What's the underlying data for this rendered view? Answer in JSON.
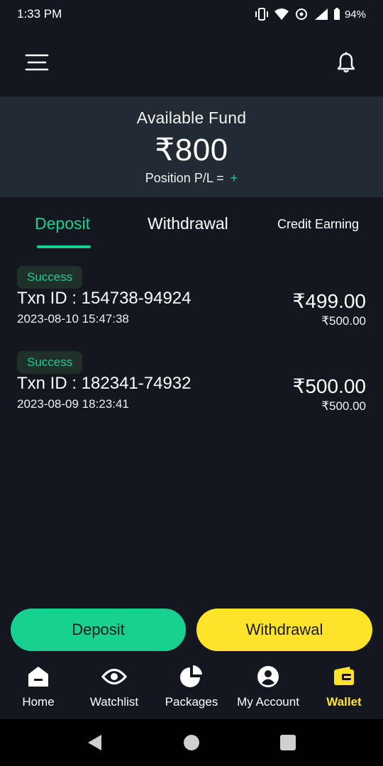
{
  "status_bar": {
    "time": "1:33 PM",
    "battery": "94%"
  },
  "header": {
    "menu_icon": "hamburger-menu-icon",
    "bell_icon": "bell-icon"
  },
  "fund": {
    "label": "Available Fund",
    "amount": "₹800",
    "pl_label": "Position P/L = ",
    "pl_value": "+"
  },
  "tabs": [
    {
      "label": "Deposit",
      "active": true
    },
    {
      "label": "Withdrawal",
      "active": false
    },
    {
      "label": "Credit Earning",
      "active": false
    }
  ],
  "transactions": [
    {
      "status": "Success",
      "txn_id": "Txn ID : 154738-94924",
      "datetime": "2023-08-10 15:47:38",
      "amount": "₹499.00",
      "sub_amount": "₹500.00"
    },
    {
      "status": "Success",
      "txn_id": "Txn ID : 182341-74932",
      "datetime": "2023-08-09 18:23:41",
      "amount": "₹500.00",
      "sub_amount": "₹500.00"
    }
  ],
  "actions": {
    "deposit_label": "Deposit",
    "withdraw_label": "Withdrawal"
  },
  "bottom_nav": [
    {
      "label": "Home",
      "icon": "home-icon",
      "active": false
    },
    {
      "label": "Watchlist",
      "icon": "eye-icon",
      "active": false
    },
    {
      "label": "Packages",
      "icon": "pie-chart-icon",
      "active": false
    },
    {
      "label": "My Account",
      "icon": "user-circle-icon",
      "active": false
    },
    {
      "label": "Wallet",
      "icon": "wallet-icon",
      "active": true
    }
  ],
  "colors": {
    "background": "#151720",
    "card": "#222b33",
    "accent_green": "#18d08f",
    "accent_yellow": "#fde42a"
  }
}
